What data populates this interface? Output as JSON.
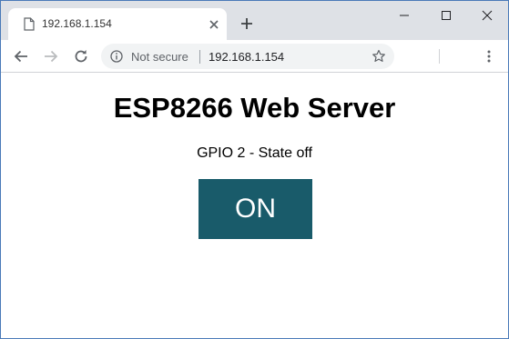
{
  "browser": {
    "tab": {
      "title": "192.168.1.154"
    },
    "address_bar": {
      "security_label": "Not secure",
      "url": "192.168.1.154"
    }
  },
  "page": {
    "title": "ESP8266 Web Server",
    "gpio_state": "GPIO 2 - State off",
    "button_label": "ON",
    "button_color": "#195b6a"
  },
  "icons": {
    "tab_favicon": "page-icon",
    "tab_close": "close-icon",
    "new_tab": "plus-icon",
    "minimize": "minimize-icon",
    "maximize": "maximize-icon",
    "close_window": "close-icon",
    "back": "arrow-left-icon",
    "forward": "arrow-right-icon",
    "reload": "reload-icon",
    "info": "info-icon",
    "bookmark": "star-icon",
    "menu": "kebab-menu-icon"
  }
}
